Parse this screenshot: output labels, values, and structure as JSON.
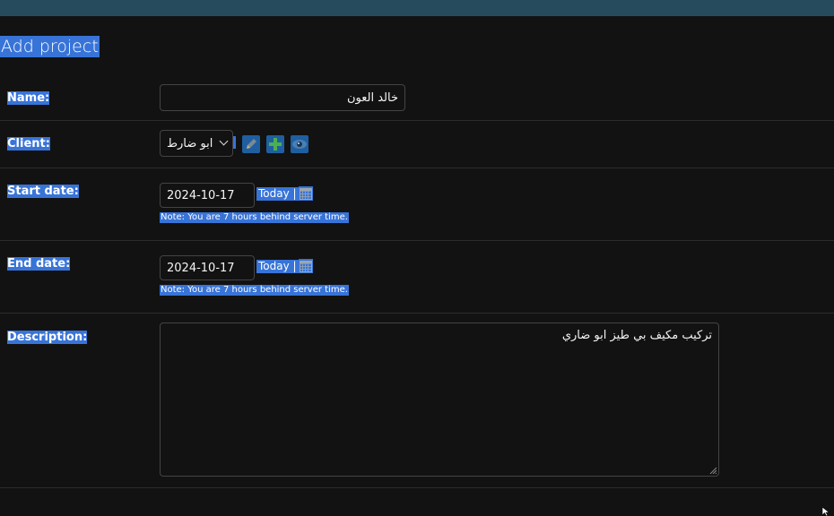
{
  "page": {
    "title": "Add project"
  },
  "form": {
    "name": {
      "label": "Name:",
      "value": "خالد العون"
    },
    "client": {
      "label": "Client:",
      "selected": "ابو ضارط",
      "options": [
        "ابو ضارط"
      ]
    },
    "start_date": {
      "label": "Start date:",
      "value": "2024-10-17",
      "today": "Today |",
      "note": "Note: You are 7 hours behind server time."
    },
    "end_date": {
      "label": "End date:",
      "value": "2024-10-17",
      "today": "Today |",
      "note": "Note: You are 7 hours behind server time."
    },
    "description": {
      "label": "Description:",
      "value": "تركيب مكيف بي طيز ابو ضاري"
    }
  },
  "icons": {
    "client_edit": "pencil-icon",
    "client_add": "plus-icon",
    "client_view": "eye-icon",
    "calendar": "calendar-icon"
  },
  "colors": {
    "background": "#121212",
    "header": "#264b5d",
    "selection": "#3874d8",
    "icon_bg": "#1f5fa0"
  }
}
